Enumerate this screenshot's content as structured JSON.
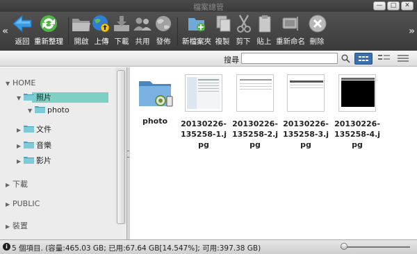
{
  "window": {
    "title": "檔案總管",
    "controls": [
      "minimize",
      "maximize",
      "close"
    ]
  },
  "toolbar": {
    "buttons": [
      {
        "label": "返回",
        "icon": "back-arrow-icon",
        "enabled": true
      },
      {
        "label": "重新整理",
        "icon": "refresh-icon",
        "enabled": true
      },
      {
        "label": "開啟",
        "icon": "open-folder-icon",
        "enabled": false
      },
      {
        "label": "上傳",
        "icon": "upload-globe-icon",
        "enabled": true
      },
      {
        "label": "下載",
        "icon": "download-tray-icon",
        "enabled": false
      },
      {
        "label": "共用",
        "icon": "share-users-icon",
        "enabled": false
      },
      {
        "label": "發佈",
        "icon": "publish-globe-icon",
        "enabled": false
      },
      {
        "label": "新檔案夾",
        "icon": "new-folder-icon",
        "enabled": true
      },
      {
        "label": "複製",
        "icon": "copy-icon",
        "enabled": false
      },
      {
        "label": "剪下",
        "icon": "scissors-icon",
        "enabled": false
      },
      {
        "label": "貼上",
        "icon": "clipboard-icon",
        "enabled": false
      },
      {
        "label": "重新命名",
        "icon": "rename-tv-icon",
        "enabled": false
      },
      {
        "label": "刪除",
        "icon": "delete-x-icon",
        "enabled": false
      }
    ]
  },
  "search": {
    "label": "搜尋",
    "value": "",
    "placeholder": ""
  },
  "sidebar": {
    "home_label": "HOME",
    "tree": [
      {
        "label": "照片",
        "level": 1,
        "expanded": true,
        "selected": true
      },
      {
        "label": "photo",
        "level": 2,
        "expanded": true,
        "selected": false
      },
      {
        "label": "文件",
        "level": 1,
        "expanded": false,
        "selected": false
      },
      {
        "label": "音樂",
        "level": 1,
        "expanded": false,
        "selected": false
      },
      {
        "label": "影片",
        "level": 1,
        "expanded": false,
        "selected": false
      }
    ],
    "sections": [
      {
        "label": "下載"
      },
      {
        "label": "PUBLIC"
      },
      {
        "label": "裝置"
      }
    ]
  },
  "files": [
    {
      "name": "photo",
      "type": "folder"
    },
    {
      "name": "20130226-135258-1.jpg",
      "type": "image"
    },
    {
      "name": "20130226-135258-2.jpg",
      "type": "image"
    },
    {
      "name": "20130226-135258-3.jpg",
      "type": "image"
    },
    {
      "name": "20130226-135258-4.jpg",
      "type": "image"
    }
  ],
  "status": {
    "text": "5 個項目. (容量:465.03 GB; 已用:67.64 GB[14.547%]; 可用:397.38 GB)"
  },
  "zoom": {
    "level": 0.02
  },
  "colors": {
    "selected_folder_bg": "#7ecfc4",
    "toolbar_bg": "#444444",
    "active_view_button": "#3a6fb0"
  }
}
